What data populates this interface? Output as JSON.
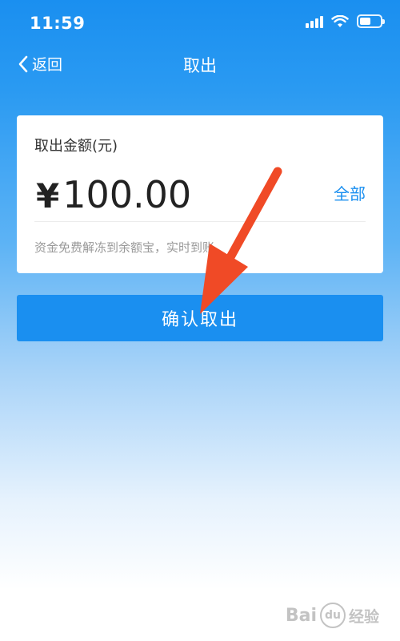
{
  "status_bar": {
    "time": "11:59"
  },
  "nav": {
    "back_label": "返回",
    "title": "取出"
  },
  "card": {
    "label": "取出金额(元)",
    "currency_symbol": "¥",
    "amount": "100.00",
    "all_link": "全部",
    "hint": "资金免费解冻到余额宝，实时到账"
  },
  "confirm_button": {
    "label": "确认取出"
  },
  "watermark": {
    "brand": "Bai",
    "brand_suffix": "经验"
  },
  "colors": {
    "accent": "#1a8ff0",
    "annotation_arrow": "#f04a26"
  },
  "icons": {
    "back": "chevron-left-icon",
    "signal": "signal-icon",
    "wifi": "wifi-icon",
    "battery": "battery-icon"
  }
}
